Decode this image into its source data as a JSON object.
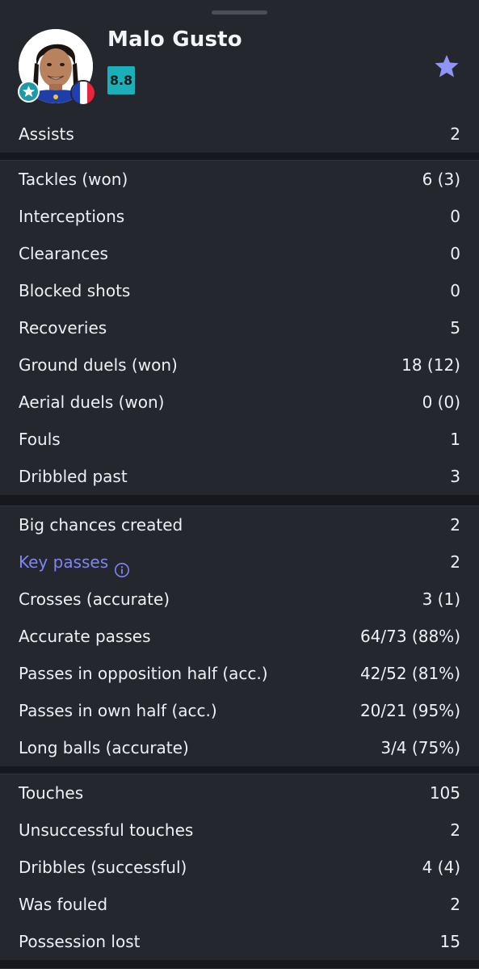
{
  "player": {
    "name": "Malo Gusto",
    "rating": "8.8",
    "avatar_icon": "player-photo",
    "team_badge_icon": "star-badge-icon",
    "flag": "france-flag-icon",
    "favorite_icon": "star-icon"
  },
  "colors": {
    "background": "#24272e",
    "separator": "#16181d",
    "rating_badge": "#1bb0b8",
    "accent": "#7f86f4",
    "text": "#eef0f3"
  },
  "sections": [
    {
      "rows": [
        {
          "label": "Assists",
          "value": "2"
        }
      ]
    },
    {
      "rows": [
        {
          "label": "Tackles (won)",
          "value": "6 (3)"
        },
        {
          "label": "Interceptions",
          "value": "0"
        },
        {
          "label": "Clearances",
          "value": "0"
        },
        {
          "label": "Blocked shots",
          "value": "0"
        },
        {
          "label": "Recoveries",
          "value": "5"
        },
        {
          "label": "Ground duels (won)",
          "value": "18 (12)"
        },
        {
          "label": "Aerial duels (won)",
          "value": "0 (0)"
        },
        {
          "label": "Fouls",
          "value": "1"
        },
        {
          "label": "Dribbled past",
          "value": "3"
        }
      ]
    },
    {
      "rows": [
        {
          "label": "Big chances created",
          "value": "2"
        },
        {
          "label": "Key passes",
          "value": "2",
          "link": true,
          "icon": "info-icon"
        },
        {
          "label": "Crosses (accurate)",
          "value": "3 (1)"
        },
        {
          "label": "Accurate passes",
          "value": "64/73 (88%)"
        },
        {
          "label": "Passes in opposition half (acc.)",
          "value": "42/52 (81%)"
        },
        {
          "label": "Passes in own half (acc.)",
          "value": "20/21 (95%)"
        },
        {
          "label": "Long balls (accurate)",
          "value": "3/4 (75%)"
        }
      ]
    },
    {
      "rows": [
        {
          "label": "Touches",
          "value": "105"
        },
        {
          "label": "Unsuccessful touches",
          "value": "2"
        },
        {
          "label": "Dribbles (successful)",
          "value": "4 (4)"
        },
        {
          "label": "Was fouled",
          "value": "2"
        },
        {
          "label": "Possession lost",
          "value": "15"
        }
      ]
    }
  ]
}
